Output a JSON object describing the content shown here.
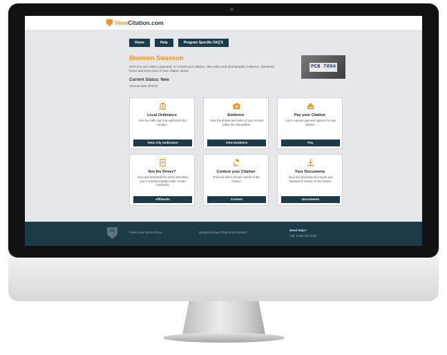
{
  "header": {
    "logo_prefix": "View",
    "logo_suffix": "Citation.com"
  },
  "nav": {
    "home": "Home",
    "help": "Help",
    "faq": "Program Specific FAQ'S"
  },
  "profile": {
    "name": "Brennen Swanson",
    "intro": "Here you can make a payment, or contest your citation, view video and photographic evidence, download forms and keep track of your citation status.",
    "status": "Current Status: New",
    "amount": "Amount Due: $75.00"
  },
  "plate": {
    "text": "PCB 7894"
  },
  "cards": [
    {
      "icon": "bank-icon",
      "title": "Local Ordinance",
      "desc": "See the traffic law that authorizes this citation.",
      "button": "View City Ordinance"
    },
    {
      "icon": "camera-icon",
      "title": "Evidence",
      "desc": "View the photos and video of your vehicle within the intersection.",
      "button": "View Evidence"
    },
    {
      "icon": "payment-icon",
      "title": "Pay your Citation",
      "desc": "Link to various payment options for your citation.",
      "button": "Pay"
    },
    {
      "icon": "document-icon",
      "title": "Not the Driver?",
      "desc": "View and download the forms that allow you to transfer liability under certain conditions.",
      "button": "Affidavits"
    },
    {
      "icon": "gavel-icon",
      "title": "Contest your Citation",
      "desc": "Proceed with a formal contest of this citation.",
      "button": "Contest"
    },
    {
      "icon": "download-icon",
      "title": "Your Documents",
      "desc": "View and download document and transaction history of this citation.",
      "button": "Documents"
    }
  ],
  "footer": {
    "logo": "VC",
    "privacy": "Privacy and Terms of Use",
    "questions": "Questions about Photo Enforcement?",
    "help_title": "Need Help?",
    "help_call": "Call: 1-855-376-6220"
  },
  "colors": {
    "accent": "#e8962b",
    "primary": "#1c3a47",
    "background": "#e6e7e8"
  }
}
